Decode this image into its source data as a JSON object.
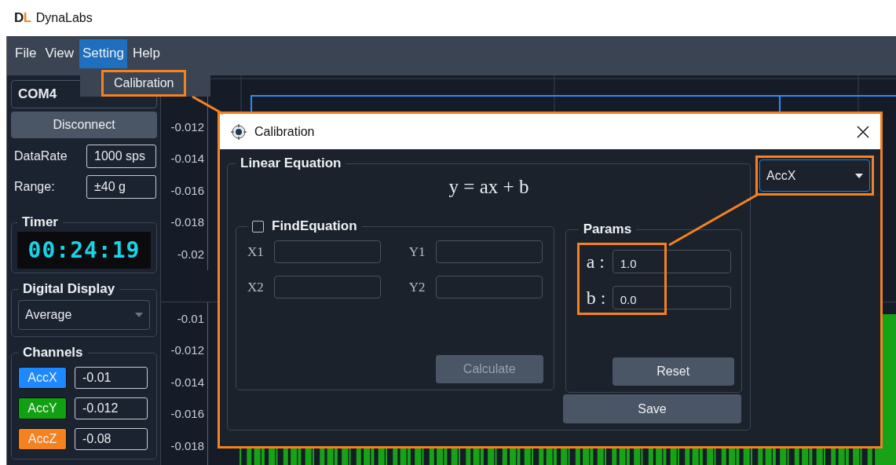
{
  "app": {
    "logo": [
      {
        "text": "D",
        "color": "#1a1a1a"
      },
      {
        "text": "L",
        "color": "#f58220"
      }
    ],
    "title": "DynaLabs"
  },
  "menu": [
    {
      "label": "File",
      "selected": false
    },
    {
      "label": "View",
      "selected": false
    },
    {
      "label": "Setting",
      "selected": true
    },
    {
      "label": "Help",
      "selected": false
    }
  ],
  "menu_popup": {
    "items": [
      {
        "label": "Calibration",
        "highlighted": true
      }
    ]
  },
  "left_panel": {
    "port": "COM4",
    "connect_button": "Disconnect",
    "data_rate": {
      "label": "DataRate",
      "value": "1000 sps"
    },
    "range": {
      "label": "Range:",
      "value": "±40 g"
    },
    "timer": {
      "title": "Timer",
      "display": "00:24:19"
    },
    "digital_display": {
      "title": "Digital Display",
      "mode": "Average"
    },
    "channels": {
      "title": "Channels",
      "items": [
        {
          "name": "AccX",
          "color": "#1e88ff",
          "value": "-0.01"
        },
        {
          "name": "AccY",
          "color": "#11a011",
          "value": "-0.012"
        },
        {
          "name": "AccZ",
          "color": "#f58220",
          "value": "-0.08"
        }
      ]
    }
  },
  "charts": [
    {
      "kind": "line",
      "y_labels": [
        "-0.012",
        "-0.014",
        "-0.016",
        "-0.018",
        "-0.02"
      ]
    },
    {
      "kind": "bars",
      "y_labels": [
        "-0.01",
        "-0.012",
        "-0.014",
        "-0.016",
        "-0.018"
      ]
    }
  ],
  "dialog": {
    "title": "Calibration",
    "highlighted": true,
    "linear_equation": {
      "title": "Linear Equation",
      "formula": "y = ax + b",
      "find_equation": {
        "title": "FindEquation",
        "checked": false,
        "fields": [
          {
            "label": "X1"
          },
          {
            "label": "Y1"
          },
          {
            "label": "X2"
          },
          {
            "label": "Y2"
          }
        ],
        "calculate_button": {
          "label": "Calculate",
          "disabled": true
        }
      },
      "params": {
        "title": "Params",
        "highlighted": true,
        "rows": [
          {
            "label": "a :",
            "value": "1.0"
          },
          {
            "label": "b :",
            "value": "0.0"
          }
        ],
        "reset_button": "Reset"
      },
      "save_button": "Save"
    },
    "channel_select": {
      "value": "AccX",
      "highlighted": true
    }
  }
}
